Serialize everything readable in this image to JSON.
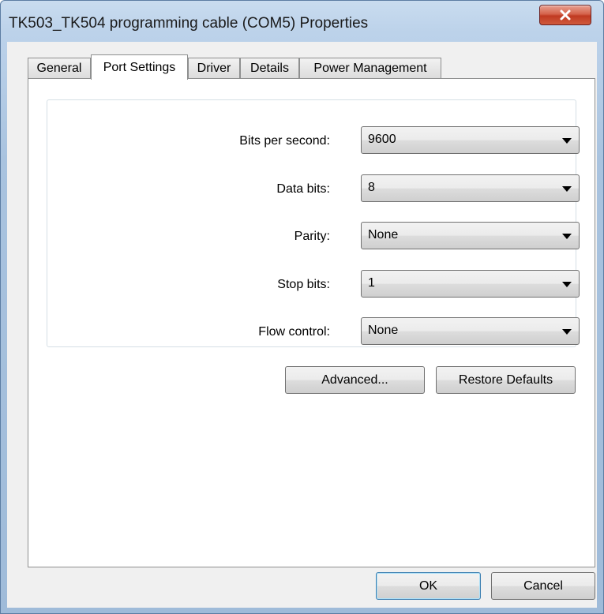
{
  "window": {
    "title": "TK503_TK504 programming cable (COM5) Properties",
    "close_icon": "close-x-icon"
  },
  "tabs": [
    {
      "label": "General",
      "active": false
    },
    {
      "label": "Port Settings",
      "active": true
    },
    {
      "label": "Driver",
      "active": false
    },
    {
      "label": "Details",
      "active": false
    },
    {
      "label": "Power Management",
      "active": false
    }
  ],
  "port_settings": {
    "bits_per_second": {
      "label": "Bits per second:",
      "value": "9600"
    },
    "data_bits": {
      "label": "Data bits:",
      "value": "8"
    },
    "parity": {
      "label": "Parity:",
      "value": "None"
    },
    "stop_bits": {
      "label": "Stop bits:",
      "value": "1"
    },
    "flow_control": {
      "label": "Flow control:",
      "value": "None"
    }
  },
  "buttons": {
    "advanced": "Advanced...",
    "restore_defaults": "Restore Defaults",
    "ok": "OK",
    "cancel": "Cancel"
  },
  "colors": {
    "close_button": "#c8462d",
    "window_frame": "#b5cde8",
    "dialog_bg": "#f0f0f0"
  }
}
